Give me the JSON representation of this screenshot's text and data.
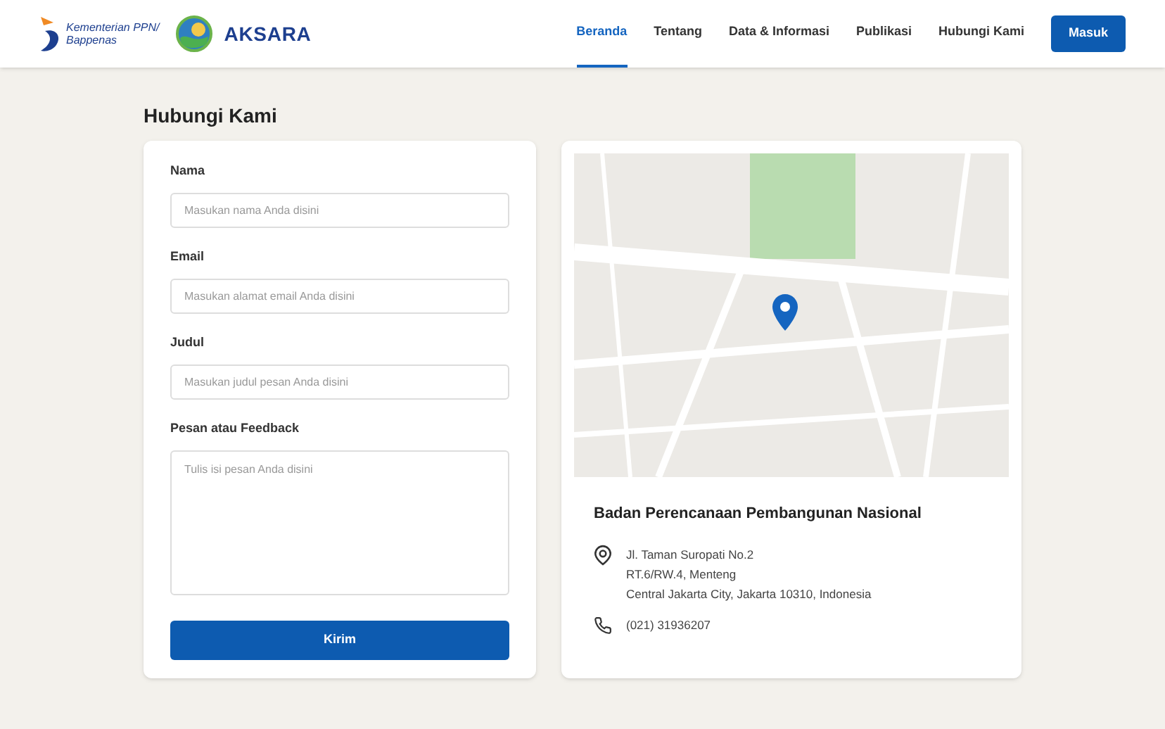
{
  "header": {
    "logo_text": [
      "Kementerian PPN/",
      "Bappenas"
    ],
    "brand": "AKSARA",
    "nav": [
      {
        "label": "Beranda",
        "selected": true
      },
      {
        "label": "Tentang",
        "selected": false
      },
      {
        "label": "Data & Informasi",
        "selected": false
      },
      {
        "label": "Publikasi",
        "selected": false
      },
      {
        "label": "Hubungi Kami",
        "selected": false
      }
    ],
    "login": "Masuk"
  },
  "page_title": "Hubungi Kami",
  "form": {
    "fields": [
      {
        "kind": "input",
        "label": "Nama",
        "placeholder": "Masukan nama Anda disini"
      },
      {
        "kind": "input",
        "label": "Email",
        "placeholder": "Masukan alamat email Anda disini"
      },
      {
        "kind": "input",
        "label": "Judul",
        "placeholder": "Masukan judul pesan Anda disini"
      },
      {
        "kind": "textarea",
        "label": "Pesan atau Feedback",
        "placeholder": "Tulis isi pesan Anda disini"
      }
    ],
    "submit": "Kirim"
  },
  "contact": {
    "name": "Badan Perencanaan Pembangunan Nasional",
    "address_lines": [
      "Jl. Taman Suropati No.2",
      "RT.6/RW.4, Menteng",
      "Central Jakarta City, Jakarta 10310, Indonesia"
    ],
    "phone": "(021) 31936207"
  }
}
